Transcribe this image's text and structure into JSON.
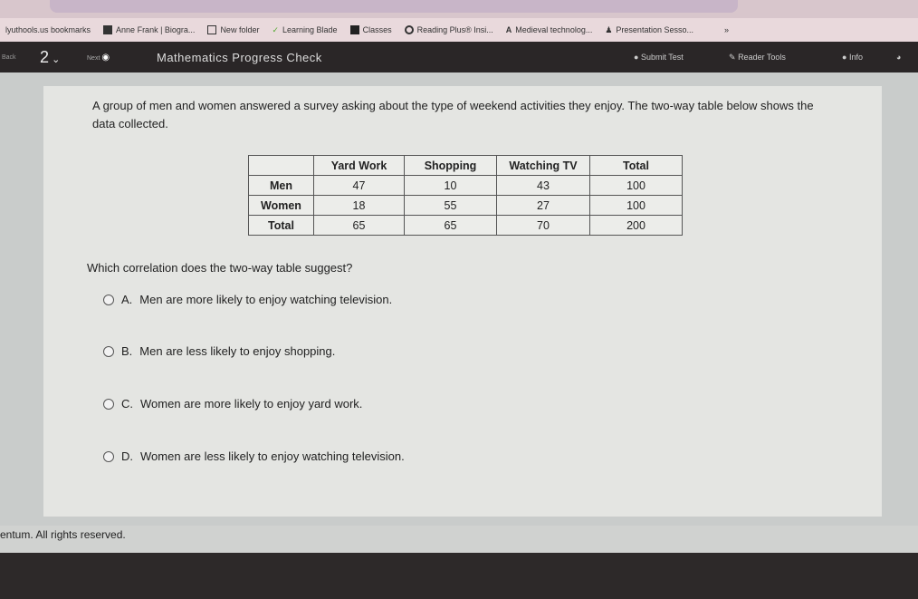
{
  "bookmarks": [
    "lyuthools.us bookmarks",
    "Anne Frank | Biogra...",
    "New folder",
    "Learning Blade",
    "Classes",
    "Reading Plus® Insi...",
    "Medieval technolog...",
    "Presentation Sesso...",
    "»"
  ],
  "header": {
    "back": "Back",
    "question_number": "2",
    "next": "Next",
    "title": "Mathematics Progress Check",
    "submit": "Submit Test",
    "reader_tools": "Reader Tools",
    "info": "Info"
  },
  "question": {
    "text": "A group of men and women answered a survey asking about the type of weekend activities they enjoy. The two-way table below shows the data collected.",
    "prompt": "Which correlation does the two-way table suggest?"
  },
  "table": {
    "headers": [
      "",
      "Yard Work",
      "Shopping",
      "Watching TV",
      "Total"
    ],
    "rows": [
      [
        "Men",
        "47",
        "10",
        "43",
        "100"
      ],
      [
        "Women",
        "18",
        "55",
        "27",
        "100"
      ],
      [
        "Total",
        "65",
        "65",
        "70",
        "200"
      ]
    ]
  },
  "options": [
    {
      "letter": "A.",
      "text": "Men are more likely to enjoy watching television."
    },
    {
      "letter": "B.",
      "text": "Men are less likely to enjoy shopping."
    },
    {
      "letter": "C.",
      "text": "Women are more likely to enjoy yard work."
    },
    {
      "letter": "D.",
      "text": "Women are less likely to enjoy watching television."
    }
  ],
  "footer": "entum. All rights reserved."
}
